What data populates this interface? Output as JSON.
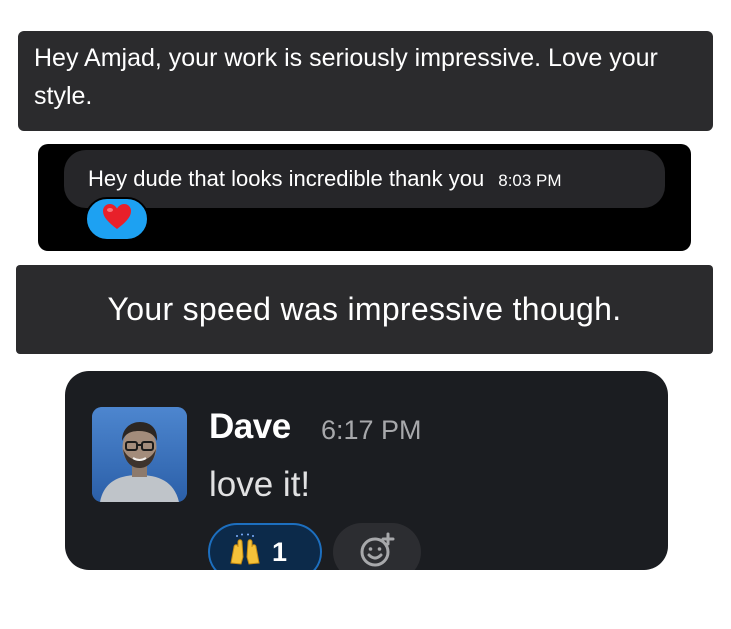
{
  "card1": {
    "message": "Hey Amjad, your work is seriously impressive. Love your style."
  },
  "card2": {
    "message": "Hey dude that looks incredible thank you",
    "time": "8:03 PM",
    "reaction_icon": "heart-icon",
    "reaction_color": "#1da1f2"
  },
  "card3": {
    "message": "Your speed was impressive though."
  },
  "card4": {
    "sender": "Dave",
    "time": "6:17 PM",
    "message": "love it!",
    "reaction": {
      "icon": "raised-hands-icon",
      "count": "1"
    },
    "add_reaction_icon": "add-reaction-icon"
  }
}
